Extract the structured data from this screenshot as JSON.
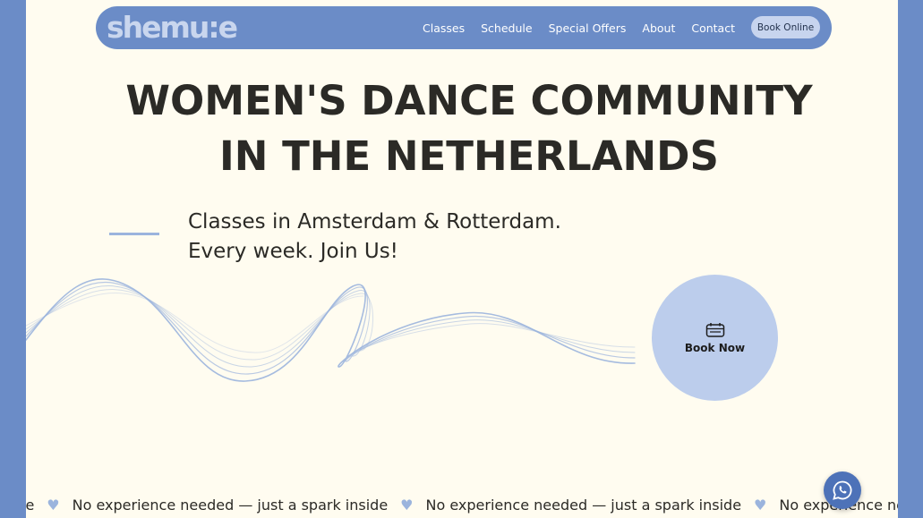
{
  "brand": {
    "logo_text": "shemu:e"
  },
  "nav": {
    "items": [
      {
        "label": "Classes"
      },
      {
        "label": "Schedule"
      },
      {
        "label": "Special Offers"
      },
      {
        "label": "About"
      },
      {
        "label": "Contact"
      }
    ],
    "book_online_label": "Book Online"
  },
  "hero": {
    "headline_line1": "WOMEN'S DANCE COMMUNITY",
    "headline_line2": "IN THE NETHERLANDS",
    "sub_line1": "Classes in Amsterdam & Rotterdam.",
    "sub_line2": "Every week. Join Us!",
    "book_now_label": "Book Now"
  },
  "marquee": {
    "fragment_start": "le",
    "text": "No experience needed — just a spark inside",
    "fragment_end": "No experience nee"
  },
  "colors": {
    "background": "#6b8cc7",
    "page": "#fffcf0",
    "accent_light": "#bccdec",
    "text": "#2b2a26"
  },
  "icons": {
    "book_now": "calendar-icon",
    "marquee_separator": "heart-icon",
    "chat": "whatsapp-icon"
  }
}
